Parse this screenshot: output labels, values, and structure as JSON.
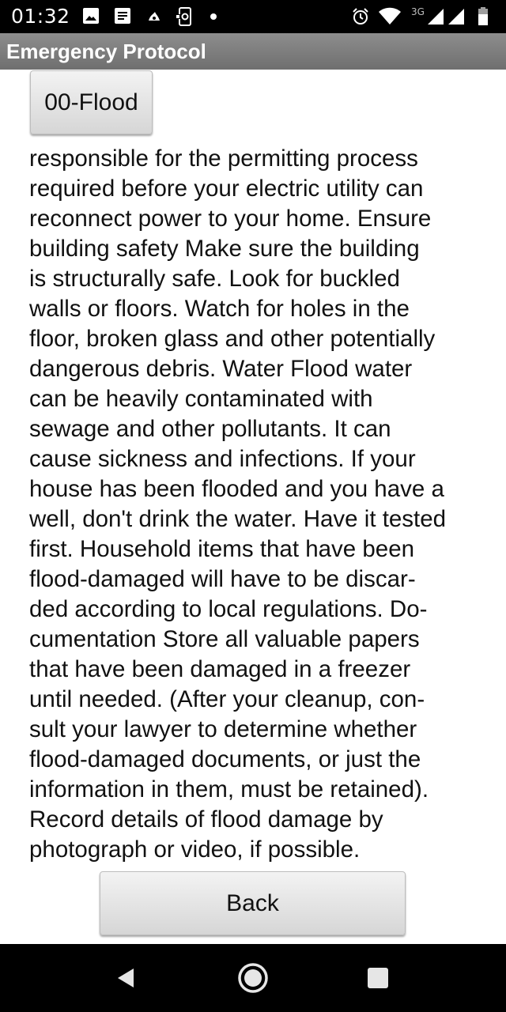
{
  "status_bar": {
    "time": "01:32",
    "network_type": "3G",
    "left_icons": [
      "image-icon",
      "message-icon",
      "app-icon",
      "screenshot-icon",
      "notification-dot"
    ],
    "right_icons": [
      "alarm-icon",
      "wifi-icon",
      "signal-icon",
      "signal-icon",
      "battery-icon"
    ]
  },
  "title_bar": {
    "title": "Emergency Protocol"
  },
  "top_button": {
    "label": "00-Flood"
  },
  "content": {
    "text": "responsible for the permitting process\nrequired before your electric utility can\nreconnect power to your home. Ensure\nbuilding safety  Make sure the building\nis structurally safe. Look for buckled\nwalls or floors. Watch for holes in the\nfloor, broken glass and other potentially\ndangerous debris. Water  Flood water\ncan be heavily contaminated with\nsewage and other pollutants. It can\ncause sickness and infections. If your\nhouse has been flooded and you have a\nwell, don't drink the water. Have it tested\nfirst. Household items that have been\nflood-damaged will have to be discar-\nded according to local regulations. Do-\ncumentation  Store all valuable papers\nthat have been damaged in a freezer\nuntil needed. (After your cleanup, con-\nsult your lawyer to determine whether\nflood-damaged documents, or just the\ninformation in them, must be retained).\nRecord details of flood damage by\nphotograph or video, if possible."
  },
  "bottom_button": {
    "label": "Back"
  },
  "nav_bar": {
    "items": [
      "back-icon",
      "home-icon",
      "recents-icon"
    ]
  },
  "colors": {
    "status_bar_bg": "#000000",
    "title_bar_bg": "#7e7e7e",
    "button_bg": "#e3e3e3",
    "text": "#111111",
    "nav_bar_bg": "#000000"
  }
}
